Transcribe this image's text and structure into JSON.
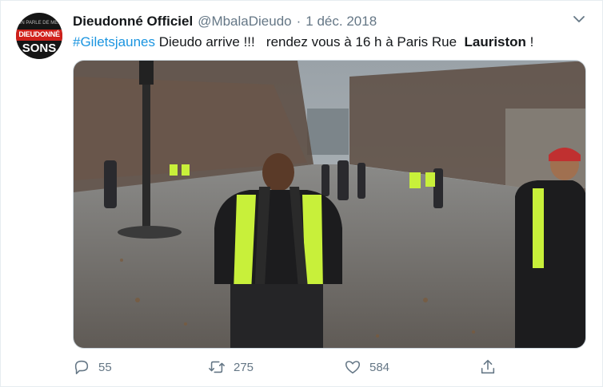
{
  "tweet": {
    "avatar_text_top": "ON PARLE DE MES",
    "avatar_text_band": "DIEUDONNÉ",
    "avatar_text_bottom": "SONS",
    "display_name": "Dieudonné Officiel",
    "handle": "@MbalaDieudo",
    "separator": "·",
    "date": "1 déc. 2018",
    "text_hashtag": "#Giletsjaunes",
    "text_middle": " Dieudo arrive !!!   rendez vous à 16 h à Paris Rue  ",
    "text_bold": "Lauriston",
    "text_end": " !"
  },
  "actions": {
    "reply_count": "55",
    "retweet_count": "275",
    "like_count": "584"
  },
  "icons": {
    "menu": "chevron-down-icon",
    "reply": "reply-icon",
    "retweet": "retweet-icon",
    "like": "heart-icon",
    "share": "share-icon"
  },
  "colors": {
    "link": "#1b95e0",
    "secondary_text": "#657786",
    "vest": "#c8f03a"
  }
}
